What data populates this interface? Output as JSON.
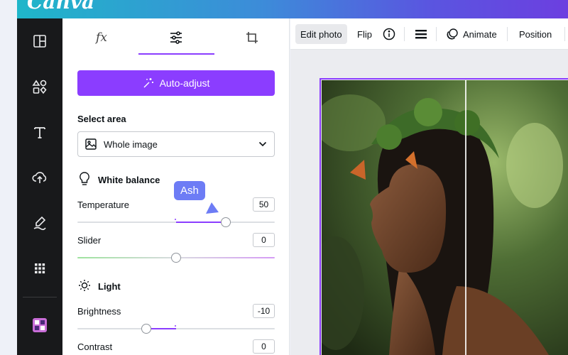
{
  "brand": {
    "logo": "Canva"
  },
  "side_rail": {
    "items": [
      "layout-icon",
      "elements-icon",
      "text-icon",
      "uploads-icon",
      "draw-icon",
      "apps-icon",
      "brand-app-icon"
    ]
  },
  "panel": {
    "tabs": [
      {
        "name": "effects",
        "icon": "fx-icon"
      },
      {
        "name": "adjust",
        "icon": "sliders-icon",
        "active": true
      },
      {
        "name": "crop",
        "icon": "crop-icon"
      }
    ],
    "auto_adjust_label": "Auto-adjust",
    "select_area": {
      "heading": "Select area",
      "value": "Whole image"
    },
    "white_balance": {
      "heading": "White balance",
      "temperature": {
        "label": "Temperature",
        "value": "50",
        "level": 50
      },
      "slider": {
        "label": "Slider",
        "value": "0",
        "level": 0
      }
    },
    "light": {
      "heading": "Light",
      "brightness": {
        "label": "Brightness",
        "value": "-10",
        "level": -10
      },
      "contrast": {
        "label": "Contrast",
        "value": "0",
        "level": 0
      }
    },
    "collaborator_tooltip": "Ash"
  },
  "toolbar": {
    "edit_photo": "Edit photo",
    "flip": "Flip",
    "animate": "Animate",
    "position": "Position"
  },
  "colors": {
    "accent": "#8b3dff",
    "rail_bg": "#18191b",
    "tooltip_bg": "#6d7cf5"
  }
}
